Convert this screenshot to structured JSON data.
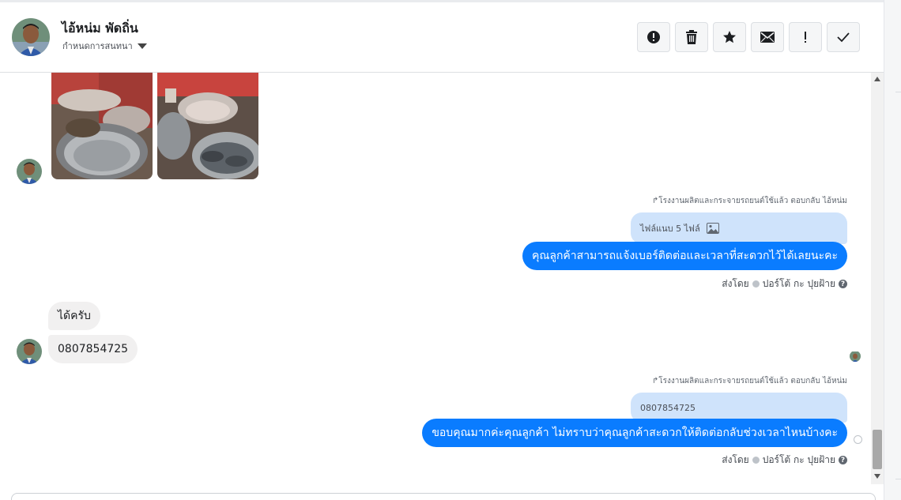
{
  "header": {
    "contact_name": "ไอ้หน่ม พัดถิ่น",
    "assign_label": "กำหนดการสนทนา",
    "toolbar": [
      {
        "name": "spam-button",
        "icon": "alert-circle-icon"
      },
      {
        "name": "delete-button",
        "icon": "trash-icon"
      },
      {
        "name": "star-button",
        "icon": "star-icon"
      },
      {
        "name": "mark-unread-button",
        "icon": "envelope-icon"
      },
      {
        "name": "follow-up-button",
        "icon": "exclamation-icon"
      },
      {
        "name": "mark-done-button",
        "icon": "checkmark-icon"
      }
    ]
  },
  "thread": {
    "reply_1": {
      "meta": "โรงงานผลิตและกระจายรถยนต์ใช้แล้ว ตอบกลับ ไอ้หน่ม",
      "quoted_text": "ไฟล์แนบ 5 ไฟล์",
      "quoted_icon": "image-icon",
      "message": "คุณลูกค้าสามารถแจ้งเบอร์ติดต่อและเวลาที่สะดวกไว้ได้เลยนะคะ",
      "sent_by_label": "ส่งโดย",
      "sender": "ปอร์โต้ กะ ปุยฝ้าย",
      "help": "?"
    },
    "incoming": [
      {
        "text": "ได้ครับ"
      },
      {
        "text": "0807854725"
      }
    ],
    "reply_2": {
      "meta": "โรงงานผลิตและกระจายรถยนต์ใช้แล้ว ตอบกลับ ไอ้หน่ม",
      "quoted_text": "0807854725",
      "message": "ขอบคุณมากค่ะคุณลูกค้า ไม่ทราบว่าคุณลูกค้าสะดวกให้ติดต่อกลับช่วงเวลาไหนบ้างคะ",
      "sent_by_label": "ส่งโดย",
      "sender": "ปอร์โต้ กะ ปุยฝ้าย",
      "help": "?"
    }
  },
  "colors": {
    "outgoing_bubble": "#0a7cff",
    "quoted_bubble": "#cfe3fb",
    "incoming_bubble": "#f1f0f0"
  }
}
